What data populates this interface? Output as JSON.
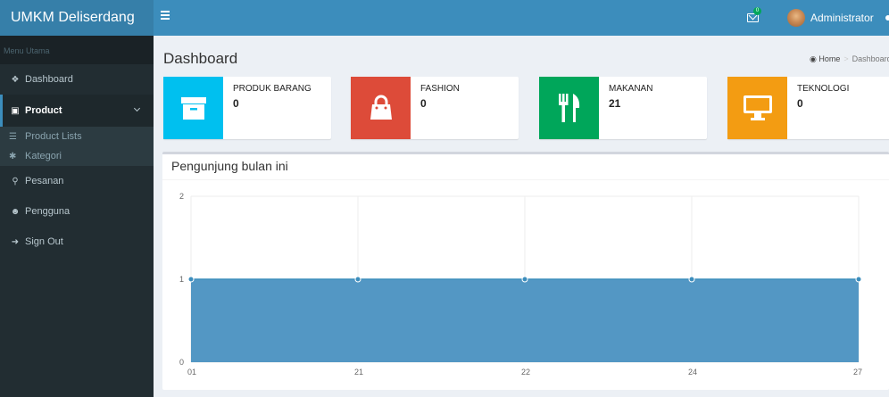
{
  "header": {
    "brand": "UMKM Deliserdang",
    "mail_badge": "0",
    "user_name": "Administrator"
  },
  "sidebar": {
    "menu_header": "Menu Utama",
    "items": [
      {
        "label": "Dashboard",
        "icon": "home-icon"
      },
      {
        "label": "Product",
        "icon": "archive-icon"
      },
      {
        "label": "Product Lists",
        "icon": "list-icon"
      },
      {
        "label": "Kategori",
        "icon": "wrench-icon"
      },
      {
        "label": "Pesanan",
        "icon": "cart-icon"
      },
      {
        "label": "Pengguna",
        "icon": "users-icon"
      },
      {
        "label": "Sign Out",
        "icon": "sign-out-icon"
      }
    ]
  },
  "page": {
    "title": "Dashboard",
    "breadcrumb_home": "Home",
    "breadcrumb_current": "Dashboard"
  },
  "info_boxes": [
    {
      "label": "PRODUK BARANG",
      "value": "0",
      "color": "#00c0ef",
      "icon": "archive-icon"
    },
    {
      "label": "FASHION",
      "value": "0",
      "color": "#dd4b39",
      "icon": "shopping-bag-icon"
    },
    {
      "label": "MAKANAN",
      "value": "21",
      "color": "#00a65a",
      "icon": "cutlery-icon"
    },
    {
      "label": "TEKNOLOGI",
      "value": "0",
      "color": "#f39c12",
      "icon": "desktop-icon"
    }
  ],
  "chart_data": {
    "type": "area",
    "title": "Pengunjung bulan ini",
    "categories": [
      "01",
      "21",
      "22",
      "24",
      "27"
    ],
    "values": [
      1,
      1,
      1,
      1,
      1
    ],
    "ylim": [
      0,
      2
    ],
    "yticks": [
      "0",
      "1",
      "2"
    ],
    "grid": true,
    "fill_color": "#5397c4",
    "line_color": "#3c8dbc"
  }
}
